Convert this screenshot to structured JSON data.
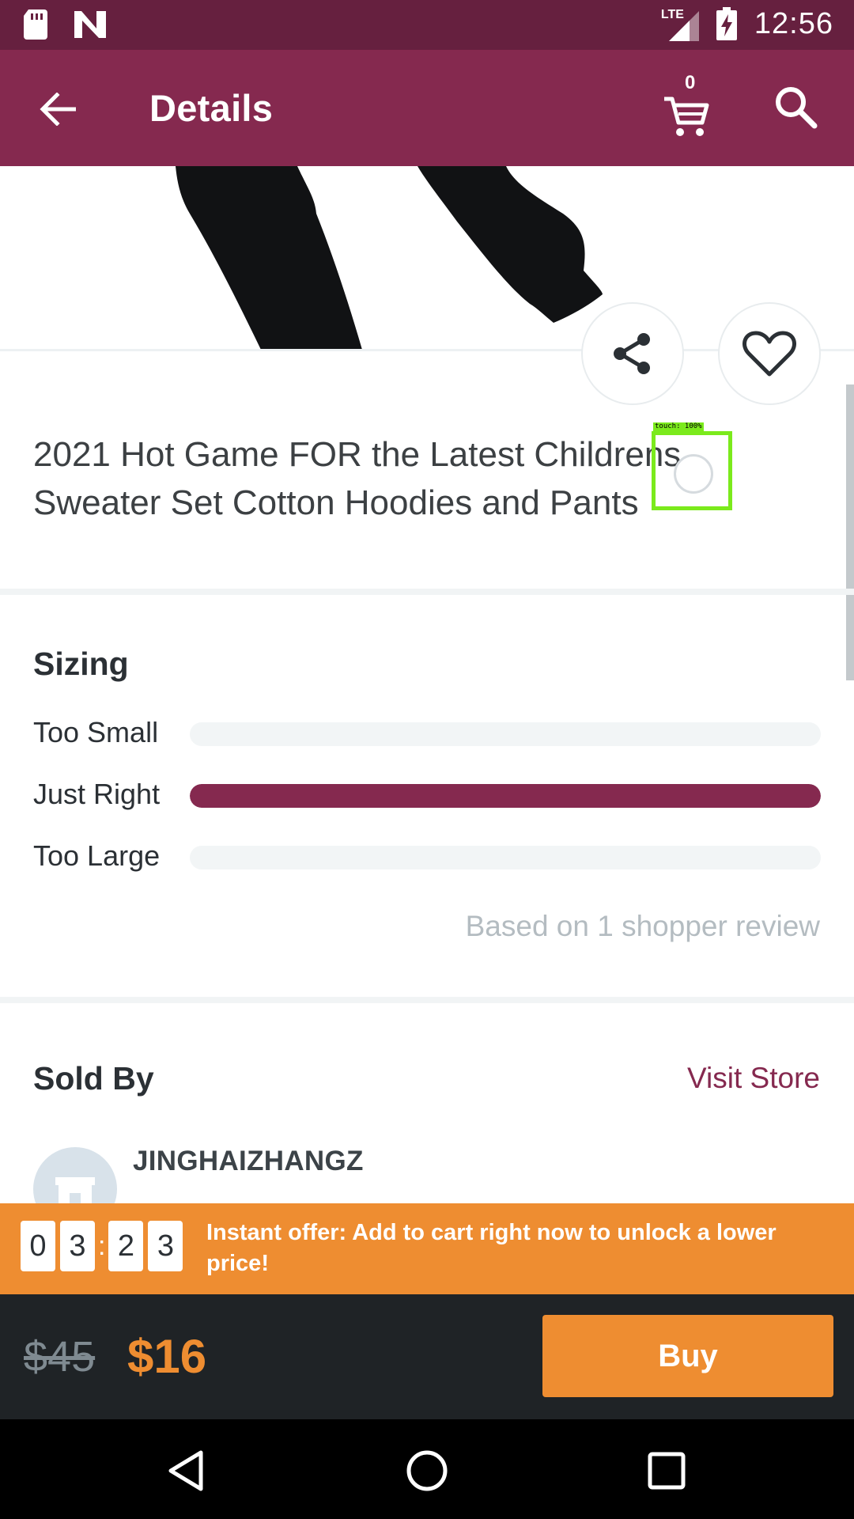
{
  "status_bar": {
    "time": "12:56",
    "network": "LTE",
    "icons": [
      "sd-card-icon",
      "n-notification-icon",
      "signal-icon",
      "battery-charging-icon"
    ]
  },
  "app_bar": {
    "title": "Details",
    "cart_count": "0",
    "icons": [
      "back-arrow-icon",
      "cart-icon",
      "search-icon"
    ]
  },
  "product": {
    "title": "2021 Hot Game FOR the Latest Childrens Sweater Set Cotton Hoodies and Pants"
  },
  "sizing": {
    "heading": "Sizing",
    "rows": [
      {
        "label": "Too Small",
        "fraction": 0
      },
      {
        "label": "Just Right",
        "fraction": 1
      },
      {
        "label": "Too Large",
        "fraction": 0
      }
    ],
    "note": "Based on 1 shopper review"
  },
  "seller": {
    "heading": "Sold By",
    "visit_label": "Visit Store",
    "name": "JINGHAIZHANGZ"
  },
  "offer": {
    "timer_digits": [
      "0",
      "3",
      "2",
      "3"
    ],
    "separator": ":",
    "text": "Instant offer: Add to cart right now to unlock a lower price!"
  },
  "purchase": {
    "old_price": "$45",
    "new_price": "$16",
    "buy_label": "Buy"
  },
  "touch_overlay": {
    "label": "touch: 100%"
  },
  "colors": {
    "status_bar": "#66203f",
    "primary": "#85294f",
    "accent": "#ee8d31",
    "buy_bar": "#1f2326"
  }
}
